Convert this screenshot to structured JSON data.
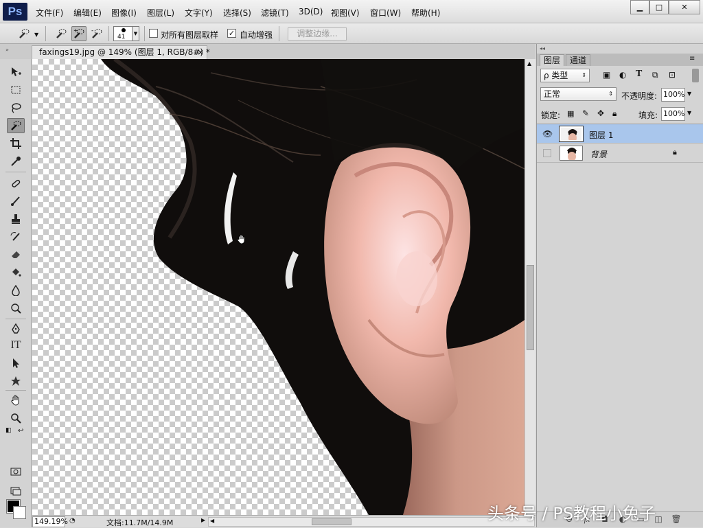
{
  "app": {
    "logo": "Ps"
  },
  "menu": [
    "文件(F)",
    "编辑(E)",
    "图像(I)",
    "图层(L)",
    "文字(Y)",
    "选择(S)",
    "滤镜(T)",
    "3D(D)",
    "视图(V)",
    "窗口(W)",
    "帮助(H)"
  ],
  "window_controls": {
    "minimize": "▁",
    "maximize": "□",
    "close": "✕"
  },
  "options": {
    "brush_size": "41",
    "sample_all_layers_label": "对所有图层取样",
    "sample_all_layers_checked": false,
    "auto_enhance_label": "自动增强",
    "auto_enhance_checked": true,
    "refine_edge_label": "调整边缘..."
  },
  "document": {
    "tab_title": "faxings19.jpg @ 149% (图层 1, RGB/8#) *",
    "close": "×"
  },
  "status": {
    "zoom": "149.19%",
    "doc_info": "文档:11.7M/14.9M"
  },
  "layers_panel": {
    "tabs": [
      "图层",
      "通道"
    ],
    "filter_kind": "ρ 类型",
    "blend_mode": "正常",
    "opacity_label": "不透明度:",
    "opacity_value": "100%",
    "lock_label": "锁定:",
    "fill_label": "填充:",
    "fill_value": "100%",
    "layers": [
      {
        "name": "图层 1",
        "visible": true,
        "selected": true,
        "locked": false
      },
      {
        "name": "背景",
        "visible": false,
        "selected": false,
        "locked": true
      }
    ]
  },
  "cursor": "hand-cursor",
  "watermark": "头条号 / PS教程小兔子",
  "colors": {
    "accent": "#a9c6ec",
    "foreground": "#000000",
    "background": "#ffffff"
  }
}
